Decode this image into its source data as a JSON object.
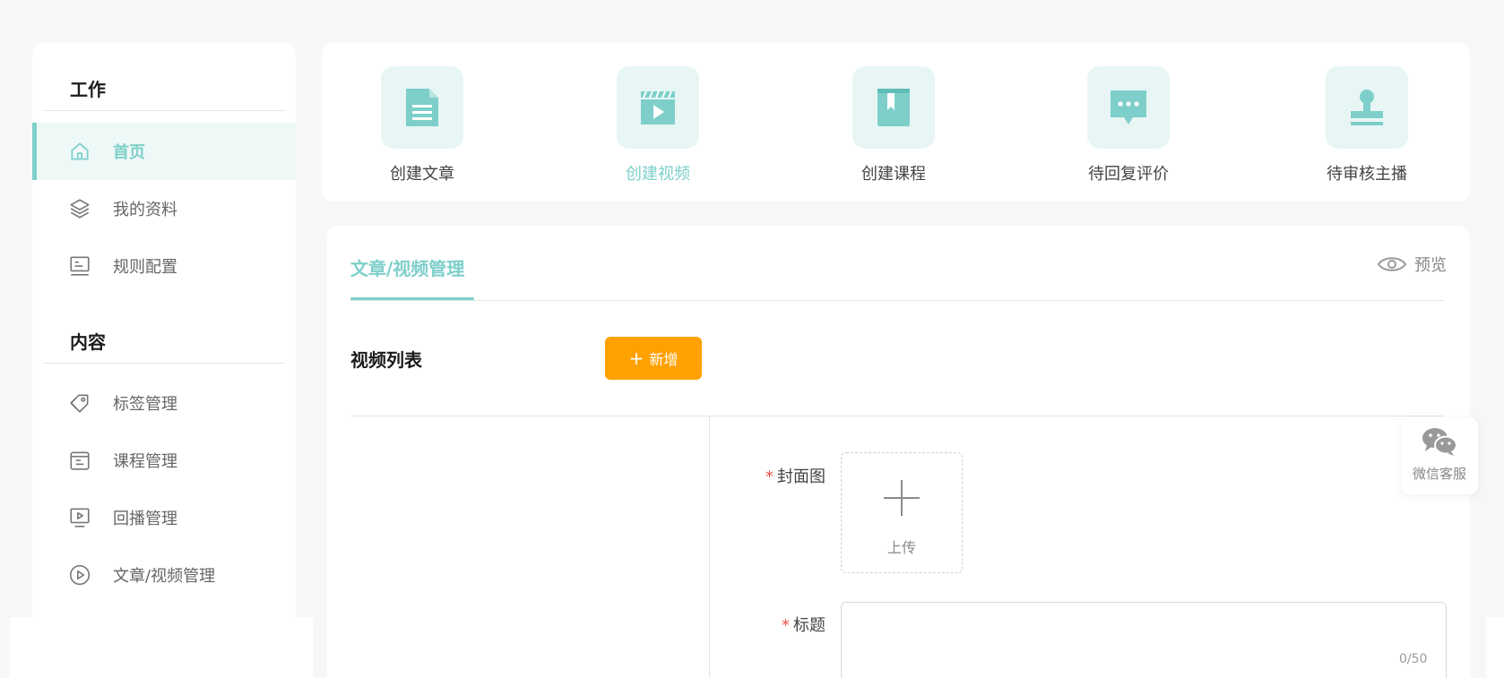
{
  "sidebar": {
    "sections": [
      {
        "title": "工作"
      },
      {
        "title": "内容"
      }
    ],
    "items": [
      {
        "label": "首页",
        "icon": "home-icon",
        "active": true
      },
      {
        "label": "我的资料",
        "icon": "layers-icon"
      },
      {
        "label": "规则配置",
        "icon": "settings-panel-icon"
      },
      {
        "label": "标签管理",
        "icon": "tag-icon"
      },
      {
        "label": "课程管理",
        "icon": "course-icon"
      },
      {
        "label": "回播管理",
        "icon": "replay-icon"
      },
      {
        "label": "文章/视频管理",
        "icon": "play-circle-icon"
      }
    ]
  },
  "quick_actions": [
    {
      "label": "创建文章",
      "icon": "document-icon"
    },
    {
      "label": "创建视频",
      "icon": "video-icon",
      "active": true
    },
    {
      "label": "创建课程",
      "icon": "book-icon"
    },
    {
      "label": "待回复评价",
      "icon": "comment-icon"
    },
    {
      "label": "待审核主播",
      "icon": "stamp-icon"
    }
  ],
  "main": {
    "tab_title": "文章/视频管理",
    "preview_label": "预览",
    "list_title": "视频列表",
    "add_button": "新增",
    "form": {
      "cover_label": "封面图",
      "required_mark": "*",
      "upload_label": "上传",
      "title_label": "标题",
      "title_value": "",
      "title_counter": "0/50"
    }
  },
  "service": {
    "label": "微信客服",
    "icon": "wechat-icon"
  },
  "colors": {
    "accent": "#7ecfca",
    "accent_bg": "#e7f6f5",
    "add_button": "#ffa100",
    "required": "#f0504a"
  }
}
